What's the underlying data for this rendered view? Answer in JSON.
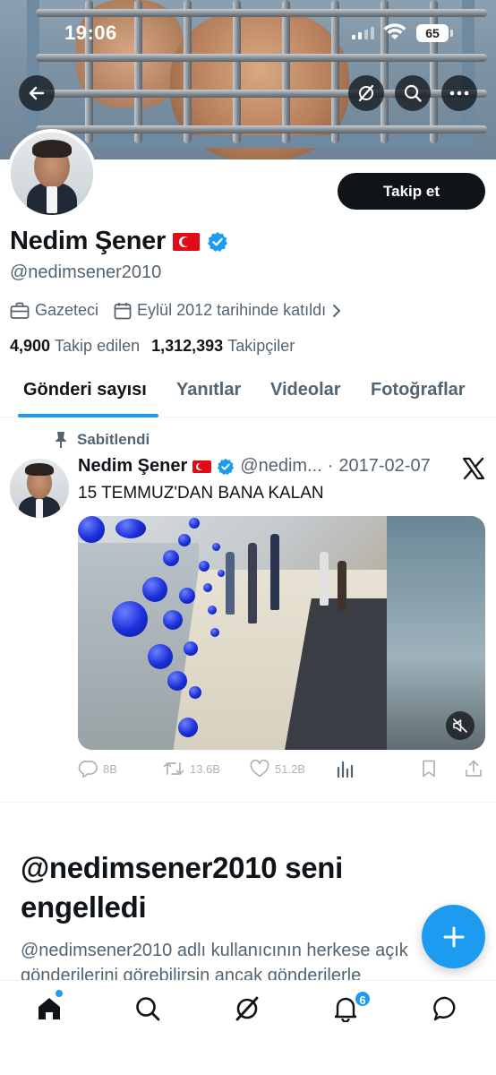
{
  "status_bar": {
    "time": "19:06",
    "battery": "65"
  },
  "profile": {
    "name": "Nedim Şener",
    "handle": "@nedimsener2010",
    "follow_label": "Takip et",
    "profession": "Gazeteci",
    "joined": "Eylül 2012 tarihinde katıldı",
    "following_count": "4,900",
    "following_label": "Takip edilen",
    "followers_count": "1,312,393",
    "followers_label": "Takipçiler"
  },
  "tabs": [
    {
      "label": "Gönderi sayısı",
      "active": true
    },
    {
      "label": "Yanıtlar",
      "active": false
    },
    {
      "label": "Videolar",
      "active": false
    },
    {
      "label": "Fotoğraflar",
      "active": false
    }
  ],
  "pinned_tweet": {
    "pinned_label": "Sabitlendi",
    "author": "Nedim Şener",
    "handle": "@nedim...",
    "separator": "·",
    "date": "2017-02-07",
    "text": "15 TEMMUZ'DAN BANA KALAN",
    "replies": "8B",
    "retweets": "13.6B",
    "likes": "51.2B"
  },
  "blocked": {
    "title": "@nedimsener2010 seni engelledi",
    "description_line1": "@nedimsener2010 adlı kullanıcının herkese açık",
    "description_line2": "gönderilerini görebilirsin ancak gönderilerle"
  },
  "nav": {
    "notifications_badge": "6"
  },
  "colors": {
    "accent": "#1d9bf0",
    "text": "#0f1419",
    "muted": "#536471",
    "follow_bg": "#0f1419"
  }
}
